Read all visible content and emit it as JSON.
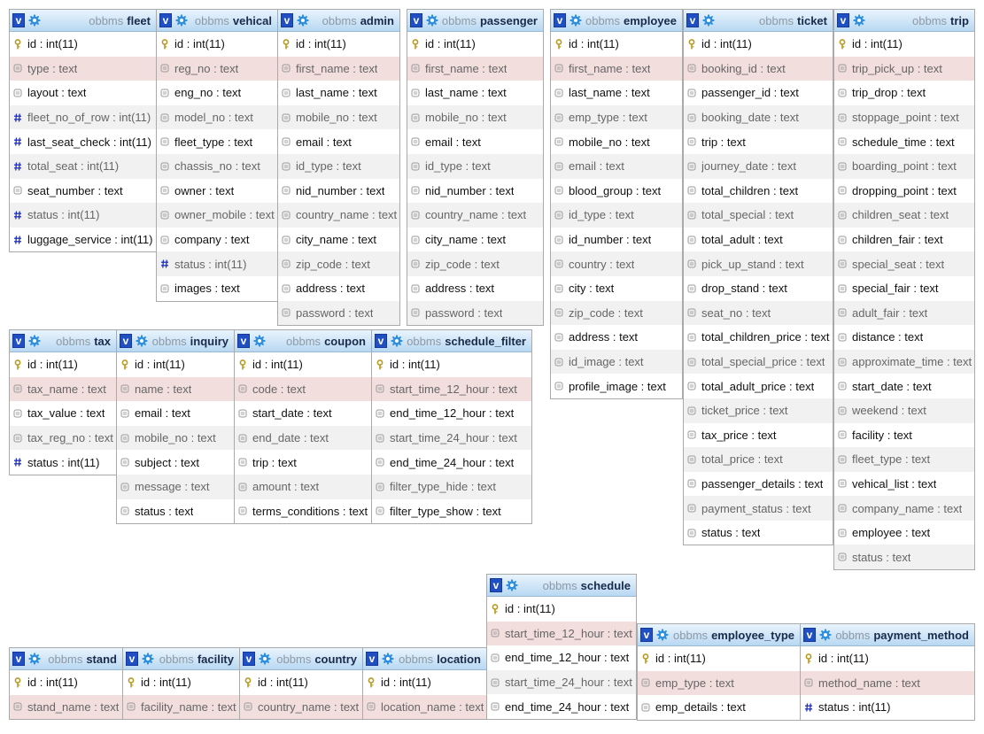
{
  "db_name": "obbms",
  "toggle_label": "v",
  "colors": {
    "key": "#b89a20",
    "text": "#9a9a9a",
    "int": "#1f2fbf",
    "header_top": "#e9f4fd",
    "header_bottom": "#b8d8f2",
    "selected_row": "#f2dedd"
  },
  "tables": [
    {
      "name": "fleet",
      "columns": [
        {
          "label": "id : int(11)",
          "icon": "key-icon"
        },
        {
          "label": "type : text",
          "icon": "text-icon"
        },
        {
          "label": "layout : text",
          "icon": "text-icon"
        },
        {
          "label": "fleet_no_of_row : int(11)",
          "icon": "int-icon"
        },
        {
          "label": "last_seat_check : int(11)",
          "icon": "int-icon"
        },
        {
          "label": "total_seat : int(11)",
          "icon": "int-icon"
        },
        {
          "label": "seat_number : text",
          "icon": "text-icon"
        },
        {
          "label": "status : int(11)",
          "icon": "int-icon"
        },
        {
          "label": "luggage_service : int(11)",
          "icon": "int-icon"
        }
      ]
    },
    {
      "name": "vehical",
      "columns": [
        {
          "label": "id : int(11)",
          "icon": "key-icon"
        },
        {
          "label": "reg_no : text",
          "icon": "text-icon"
        },
        {
          "label": "eng_no : text",
          "icon": "text-icon"
        },
        {
          "label": "model_no : text",
          "icon": "text-icon"
        },
        {
          "label": "fleet_type : text",
          "icon": "text-icon"
        },
        {
          "label": "chassis_no : text",
          "icon": "text-icon"
        },
        {
          "label": "owner : text",
          "icon": "text-icon"
        },
        {
          "label": "owner_mobile : text",
          "icon": "text-icon"
        },
        {
          "label": "company : text",
          "icon": "text-icon"
        },
        {
          "label": "status : int(11)",
          "icon": "int-icon"
        },
        {
          "label": "images : text",
          "icon": "text-icon"
        }
      ]
    },
    {
      "name": "admin",
      "columns": [
        {
          "label": "id : int(11)",
          "icon": "key-icon"
        },
        {
          "label": "first_name : text",
          "icon": "text-icon"
        },
        {
          "label": "last_name : text",
          "icon": "text-icon"
        },
        {
          "label": "mobile_no : text",
          "icon": "text-icon"
        },
        {
          "label": "email : text",
          "icon": "text-icon"
        },
        {
          "label": "id_type : text",
          "icon": "text-icon"
        },
        {
          "label": "nid_number : text",
          "icon": "text-icon"
        },
        {
          "label": "country_name : text",
          "icon": "text-icon"
        },
        {
          "label": "city_name : text",
          "icon": "text-icon"
        },
        {
          "label": "zip_code : text",
          "icon": "text-icon"
        },
        {
          "label": "address : text",
          "icon": "text-icon"
        },
        {
          "label": "password : text",
          "icon": "text-icon"
        }
      ]
    },
    {
      "name": "passenger",
      "columns": [
        {
          "label": "id : int(11)",
          "icon": "key-icon"
        },
        {
          "label": "first_name : text",
          "icon": "text-icon"
        },
        {
          "label": "last_name : text",
          "icon": "text-icon"
        },
        {
          "label": "mobile_no : text",
          "icon": "text-icon"
        },
        {
          "label": "email : text",
          "icon": "text-icon"
        },
        {
          "label": "id_type : text",
          "icon": "text-icon"
        },
        {
          "label": "nid_number : text",
          "icon": "text-icon"
        },
        {
          "label": "country_name : text",
          "icon": "text-icon"
        },
        {
          "label": "city_name : text",
          "icon": "text-icon"
        },
        {
          "label": "zip_code : text",
          "icon": "text-icon"
        },
        {
          "label": "address : text",
          "icon": "text-icon"
        },
        {
          "label": "password : text",
          "icon": "text-icon"
        }
      ]
    },
    {
      "name": "employee",
      "columns": [
        {
          "label": "id : int(11)",
          "icon": "key-icon"
        },
        {
          "label": "first_name : text",
          "icon": "text-icon"
        },
        {
          "label": "last_name : text",
          "icon": "text-icon"
        },
        {
          "label": "emp_type : text",
          "icon": "text-icon"
        },
        {
          "label": "mobile_no : text",
          "icon": "text-icon"
        },
        {
          "label": "email : text",
          "icon": "text-icon"
        },
        {
          "label": "blood_group : text",
          "icon": "text-icon"
        },
        {
          "label": "id_type : text",
          "icon": "text-icon"
        },
        {
          "label": "id_number : text",
          "icon": "text-icon"
        },
        {
          "label": "country : text",
          "icon": "text-icon"
        },
        {
          "label": "city : text",
          "icon": "text-icon"
        },
        {
          "label": "zip_code : text",
          "icon": "text-icon"
        },
        {
          "label": "address : text",
          "icon": "text-icon"
        },
        {
          "label": "id_image : text",
          "icon": "text-icon"
        },
        {
          "label": "profile_image : text",
          "icon": "text-icon"
        }
      ]
    },
    {
      "name": "ticket",
      "columns": [
        {
          "label": "id : int(11)",
          "icon": "key-icon"
        },
        {
          "label": "booking_id : text",
          "icon": "text-icon"
        },
        {
          "label": "passenger_id : text",
          "icon": "text-icon"
        },
        {
          "label": "booking_date : text",
          "icon": "text-icon"
        },
        {
          "label": "trip : text",
          "icon": "text-icon"
        },
        {
          "label": "journey_date : text",
          "icon": "text-icon"
        },
        {
          "label": "total_children : text",
          "icon": "text-icon"
        },
        {
          "label": "total_special : text",
          "icon": "text-icon"
        },
        {
          "label": "total_adult : text",
          "icon": "text-icon"
        },
        {
          "label": "pick_up_stand : text",
          "icon": "text-icon"
        },
        {
          "label": "drop_stand : text",
          "icon": "text-icon"
        },
        {
          "label": "seat_no : text",
          "icon": "text-icon"
        },
        {
          "label": "total_children_price : text",
          "icon": "text-icon"
        },
        {
          "label": "total_special_price : text",
          "icon": "text-icon"
        },
        {
          "label": "total_adult_price : text",
          "icon": "text-icon"
        },
        {
          "label": "ticket_price : text",
          "icon": "text-icon"
        },
        {
          "label": "tax_price : text",
          "icon": "text-icon"
        },
        {
          "label": "total_price : text",
          "icon": "text-icon"
        },
        {
          "label": "passenger_details : text",
          "icon": "text-icon"
        },
        {
          "label": "payment_status : text",
          "icon": "text-icon"
        },
        {
          "label": "status : text",
          "icon": "text-icon"
        }
      ]
    },
    {
      "name": "trip",
      "columns": [
        {
          "label": "id : int(11)",
          "icon": "key-icon"
        },
        {
          "label": "trip_pick_up : text",
          "icon": "text-icon"
        },
        {
          "label": "trip_drop : text",
          "icon": "text-icon"
        },
        {
          "label": "stoppage_point : text",
          "icon": "text-icon"
        },
        {
          "label": "schedule_time : text",
          "icon": "text-icon"
        },
        {
          "label": "boarding_point : text",
          "icon": "text-icon"
        },
        {
          "label": "dropping_point : text",
          "icon": "text-icon"
        },
        {
          "label": "children_seat : text",
          "icon": "text-icon"
        },
        {
          "label": "children_fair : text",
          "icon": "text-icon"
        },
        {
          "label": "special_seat : text",
          "icon": "text-icon"
        },
        {
          "label": "special_fair : text",
          "icon": "text-icon"
        },
        {
          "label": "adult_fair : text",
          "icon": "text-icon"
        },
        {
          "label": "distance : text",
          "icon": "text-icon"
        },
        {
          "label": "approximate_time : text",
          "icon": "text-icon"
        },
        {
          "label": "start_date : text",
          "icon": "text-icon"
        },
        {
          "label": "weekend : text",
          "icon": "text-icon"
        },
        {
          "label": "facility : text",
          "icon": "text-icon"
        },
        {
          "label": "fleet_type : text",
          "icon": "text-icon"
        },
        {
          "label": "vehical_list : text",
          "icon": "text-icon"
        },
        {
          "label": "company_name : text",
          "icon": "text-icon"
        },
        {
          "label": "employee : text",
          "icon": "text-icon"
        },
        {
          "label": "status : text",
          "icon": "text-icon"
        }
      ]
    },
    {
      "name": "tax",
      "columns": [
        {
          "label": "id : int(11)",
          "icon": "key-icon"
        },
        {
          "label": "tax_name : text",
          "icon": "text-icon"
        },
        {
          "label": "tax_value : text",
          "icon": "text-icon"
        },
        {
          "label": "tax_reg_no : text",
          "icon": "text-icon"
        },
        {
          "label": "status : int(11)",
          "icon": "int-icon"
        }
      ]
    },
    {
      "name": "inquiry",
      "columns": [
        {
          "label": "id : int(11)",
          "icon": "key-icon"
        },
        {
          "label": "name : text",
          "icon": "text-icon"
        },
        {
          "label": "email : text",
          "icon": "text-icon"
        },
        {
          "label": "mobile_no : text",
          "icon": "text-icon"
        },
        {
          "label": "subject : text",
          "icon": "text-icon"
        },
        {
          "label": "message : text",
          "icon": "text-icon"
        },
        {
          "label": "status : text",
          "icon": "text-icon"
        }
      ]
    },
    {
      "name": "coupon",
      "columns": [
        {
          "label": "id : int(11)",
          "icon": "key-icon"
        },
        {
          "label": "code : text",
          "icon": "text-icon"
        },
        {
          "label": "start_date : text",
          "icon": "text-icon"
        },
        {
          "label": "end_date : text",
          "icon": "text-icon"
        },
        {
          "label": "trip : text",
          "icon": "text-icon"
        },
        {
          "label": "amount : text",
          "icon": "text-icon"
        },
        {
          "label": "terms_conditions : text",
          "icon": "text-icon"
        }
      ]
    },
    {
      "name": "schedule_filter",
      "columns": [
        {
          "label": "id : int(11)",
          "icon": "key-icon"
        },
        {
          "label": "start_time_12_hour : text",
          "icon": "text-icon"
        },
        {
          "label": "end_time_12_hour : text",
          "icon": "text-icon"
        },
        {
          "label": "start_time_24_hour : text",
          "icon": "text-icon"
        },
        {
          "label": "end_time_24_hour : text",
          "icon": "text-icon"
        },
        {
          "label": "filter_type_hide : text",
          "icon": "text-icon"
        },
        {
          "label": "filter_type_show : text",
          "icon": "text-icon"
        }
      ]
    },
    {
      "name": "schedule",
      "columns": [
        {
          "label": "id : int(11)",
          "icon": "key-icon"
        },
        {
          "label": "start_time_12_hour : text",
          "icon": "text-icon"
        },
        {
          "label": "end_time_12_hour : text",
          "icon": "text-icon"
        },
        {
          "label": "start_time_24_hour : text",
          "icon": "text-icon"
        },
        {
          "label": "end_time_24_hour : text",
          "icon": "text-icon"
        }
      ]
    },
    {
      "name": "employee_type",
      "columns": [
        {
          "label": "id : int(11)",
          "icon": "key-icon"
        },
        {
          "label": "emp_type : text",
          "icon": "text-icon"
        },
        {
          "label": "emp_details : text",
          "icon": "text-icon"
        }
      ]
    },
    {
      "name": "payment_method",
      "columns": [
        {
          "label": "id : int(11)",
          "icon": "key-icon"
        },
        {
          "label": "method_name : text",
          "icon": "text-icon"
        },
        {
          "label": "status : int(11)",
          "icon": "int-icon"
        }
      ]
    },
    {
      "name": "stand",
      "columns": [
        {
          "label": "id : int(11)",
          "icon": "key-icon"
        },
        {
          "label": "stand_name : text",
          "icon": "text-icon"
        }
      ]
    },
    {
      "name": "facility",
      "columns": [
        {
          "label": "id : int(11)",
          "icon": "key-icon"
        },
        {
          "label": "facility_name : text",
          "icon": "text-icon"
        }
      ]
    },
    {
      "name": "country",
      "columns": [
        {
          "label": "id : int(11)",
          "icon": "key-icon"
        },
        {
          "label": "country_name : text",
          "icon": "text-icon"
        }
      ]
    },
    {
      "name": "location",
      "columns": [
        {
          "label": "id : int(11)",
          "icon": "key-icon"
        },
        {
          "label": "location_name : text",
          "icon": "text-icon"
        }
      ]
    }
  ]
}
